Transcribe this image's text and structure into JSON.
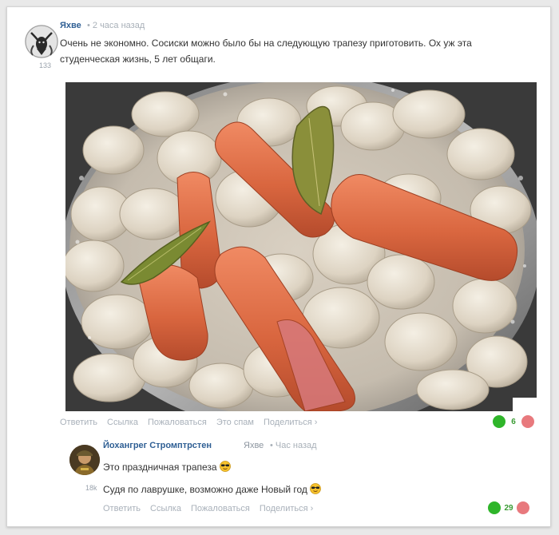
{
  "comment": {
    "author": "Яхве",
    "time": "• 2 часа назад",
    "score": "133",
    "text_line1": "Очень не экономно. Сосиски можно было бы на следующую трапезу приготовить. Ох уж эта",
    "text_line2": "студенческая жизнь, 5 лет общаги.",
    "actions": {
      "reply": "Ответить",
      "link": "Ссылка",
      "report": "Пожаловаться",
      "spam": "Это спам",
      "share": "Поделиться ›"
    },
    "votes": {
      "up": "6"
    },
    "image_description_icon": "pot-of-dumplings-and-sausages-photo"
  },
  "reply": {
    "author": "Йохангрег Стромптрстен",
    "reply_to": "Яхве",
    "time": "• Час назад",
    "score": "18k",
    "line1": "Это праздничная трапеза",
    "line2": "Судя по лаврушке, возможно даже Новый год",
    "emoji_icon": "sunglasses-face-icon",
    "actions": {
      "reply": "Ответить",
      "link": "Ссылка",
      "report": "Пожаловаться",
      "share": "Поделиться ›"
    },
    "votes": {
      "up": "29"
    }
  },
  "colors": {
    "author": "#2f5f94",
    "upvote": "#2fb52a",
    "downvote": "#e8797d",
    "muted": "#a9b1ba"
  }
}
